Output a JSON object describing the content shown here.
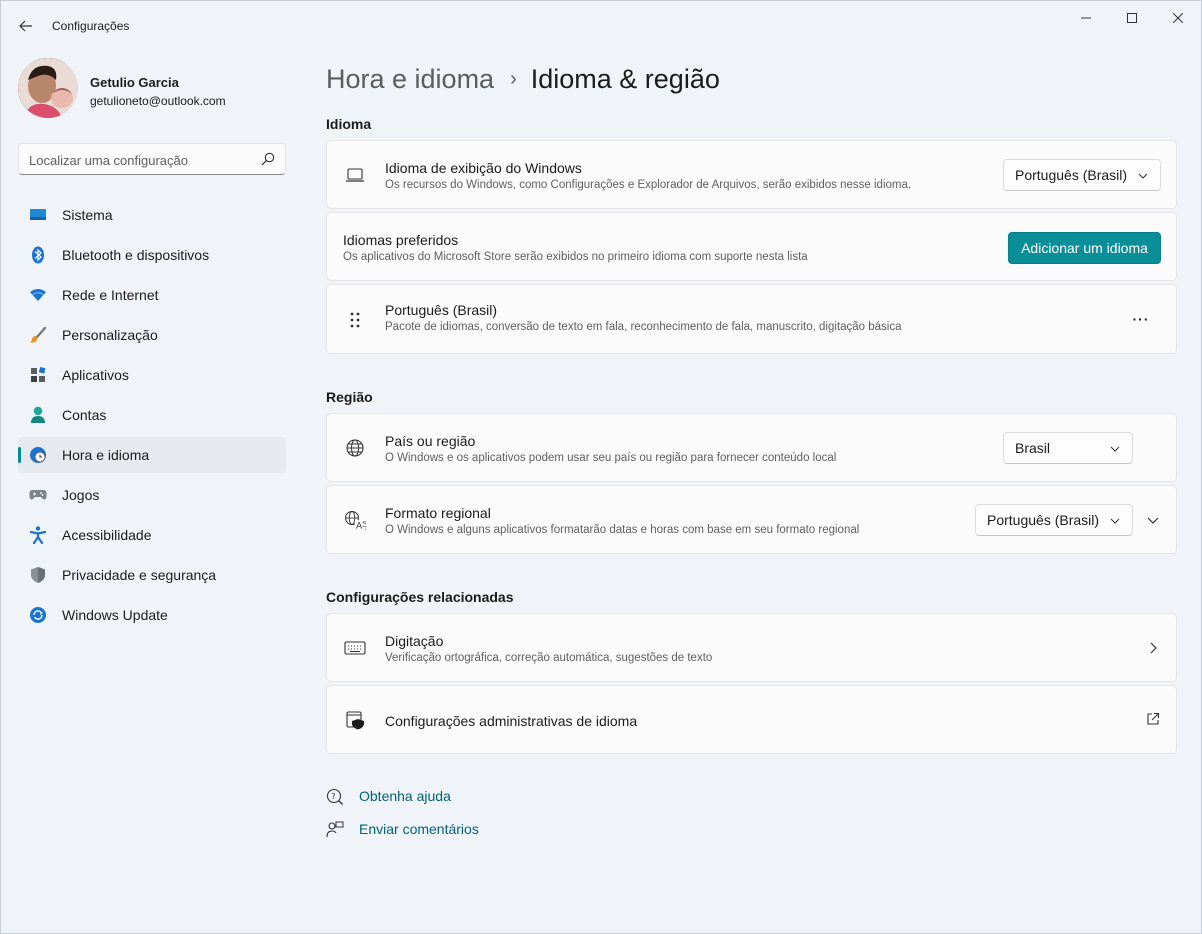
{
  "window": {
    "title": "Configurações"
  },
  "profile": {
    "name": "Getulio Garcia",
    "email": "getulioneto@outlook.com"
  },
  "search": {
    "placeholder": "Localizar uma configuração"
  },
  "sidebar": {
    "items": [
      {
        "label": "Sistema",
        "icon": "system-icon"
      },
      {
        "label": "Bluetooth e dispositivos",
        "icon": "bluetooth-icon"
      },
      {
        "label": "Rede e Internet",
        "icon": "wifi-icon"
      },
      {
        "label": "Personalização",
        "icon": "brush-icon"
      },
      {
        "label": "Aplicativos",
        "icon": "apps-icon"
      },
      {
        "label": "Contas",
        "icon": "account-icon"
      },
      {
        "label": "Hora e idioma",
        "icon": "time-language-icon",
        "active": true
      },
      {
        "label": "Jogos",
        "icon": "gamepad-icon"
      },
      {
        "label": "Acessibilidade",
        "icon": "accessibility-icon"
      },
      {
        "label": "Privacidade e segurança",
        "icon": "shield-icon"
      },
      {
        "label": "Windows Update",
        "icon": "update-icon"
      }
    ]
  },
  "header": {
    "parent": "Hora e idioma",
    "separator": "›",
    "current": "Idioma & região"
  },
  "sections": {
    "language": "Idioma",
    "region": "Região",
    "related": "Configurações relacionadas"
  },
  "cards": {
    "display_language": {
      "title": "Idioma de exibição do Windows",
      "subtitle": "Os recursos do Windows, como Configurações e Explorador de Arquivos, serão exibidos nesse idioma.",
      "value": "Português (Brasil)"
    },
    "preferred_languages": {
      "title": "Idiomas preferidos",
      "subtitle": "Os aplicativos do Microsoft Store serão exibidos no primeiro idioma com suporte nesta lista",
      "button": "Adicionar um idioma"
    },
    "language_pack": {
      "title": "Português (Brasil)",
      "subtitle": "Pacote de idiomas, conversão de texto em fala, reconhecimento de fala, manuscrito, digitação básica",
      "more": "···"
    },
    "country": {
      "title": "País ou região",
      "subtitle": "O Windows e os aplicativos podem usar seu país ou região para fornecer conteúdo local",
      "value": "Brasil"
    },
    "regional_format": {
      "title": "Formato regional",
      "subtitle": "O Windows e alguns aplicativos formatarão datas e horas com base em seu formato regional",
      "value": "Português (Brasil)"
    },
    "typing": {
      "title": "Digitação",
      "subtitle": "Verificação ortográfica, correção automática, sugestões de texto"
    },
    "admin_language": {
      "title": "Configurações administrativas de idioma"
    }
  },
  "footer": {
    "help": "Obtenha ajuda",
    "feedback": "Enviar comentários"
  },
  "colors": {
    "accent": "#0a8f99",
    "link": "#00607a",
    "sidebar_active": "#e6eaef"
  }
}
